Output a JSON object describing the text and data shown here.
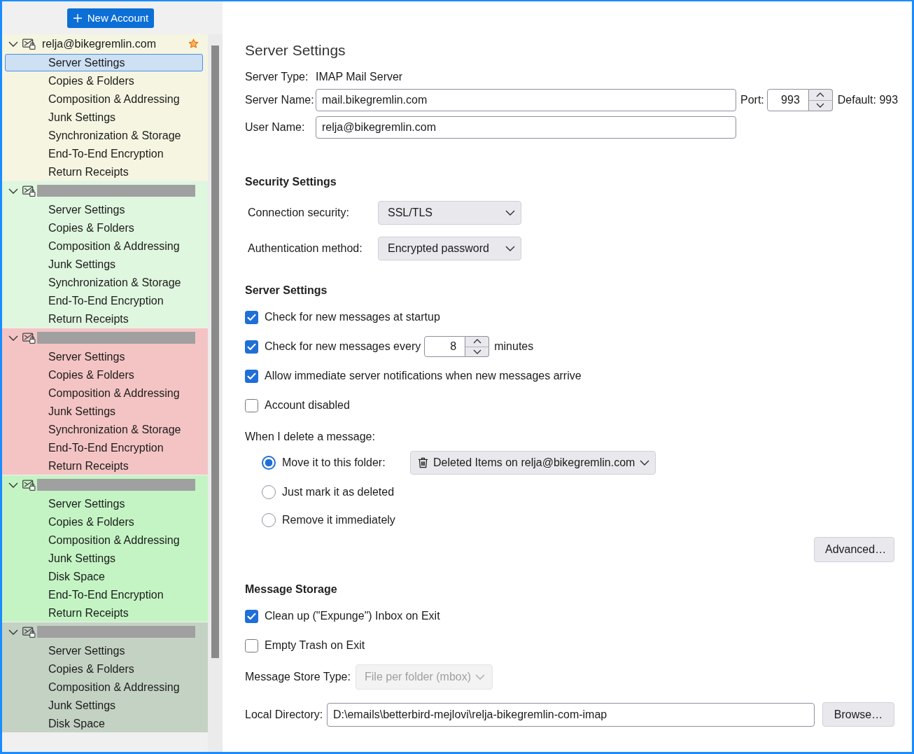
{
  "sidebar": {
    "new_account_button": "New Account",
    "accounts": [
      {
        "name": "relja@bikegremlin.com",
        "redacted": false,
        "default": true,
        "expanded": true,
        "color": "#f5f5e1",
        "items": [
          {
            "label": "Server Settings",
            "selected": true
          },
          {
            "label": "Copies & Folders",
            "selected": false
          },
          {
            "label": "Composition & Addressing",
            "selected": false
          },
          {
            "label": "Junk Settings",
            "selected": false
          },
          {
            "label": "Synchronization & Storage",
            "selected": false
          },
          {
            "label": "End-To-End Encryption",
            "selected": false
          },
          {
            "label": "Return Receipts",
            "selected": false
          }
        ]
      },
      {
        "redacted": true,
        "default": false,
        "expanded": true,
        "color": "#dff6df",
        "items": [
          {
            "label": "Server Settings",
            "selected": false
          },
          {
            "label": "Copies & Folders",
            "selected": false
          },
          {
            "label": "Composition & Addressing",
            "selected": false
          },
          {
            "label": "Junk Settings",
            "selected": false
          },
          {
            "label": "Synchronization & Storage",
            "selected": false
          },
          {
            "label": "End-To-End Encryption",
            "selected": false
          },
          {
            "label": "Return Receipts",
            "selected": false
          }
        ]
      },
      {
        "redacted": true,
        "default": false,
        "expanded": true,
        "color": "#f4c4c4",
        "items": [
          {
            "label": "Server Settings",
            "selected": false
          },
          {
            "label": "Copies & Folders",
            "selected": false
          },
          {
            "label": "Composition & Addressing",
            "selected": false
          },
          {
            "label": "Junk Settings",
            "selected": false
          },
          {
            "label": "Synchronization & Storage",
            "selected": false
          },
          {
            "label": "End-To-End Encryption",
            "selected": false
          },
          {
            "label": "Return Receipts",
            "selected": false
          }
        ]
      },
      {
        "redacted": true,
        "default": false,
        "expanded": true,
        "color": "#c4f4c4",
        "items": [
          {
            "label": "Server Settings",
            "selected": false
          },
          {
            "label": "Copies & Folders",
            "selected": false
          },
          {
            "label": "Composition & Addressing",
            "selected": false
          },
          {
            "label": "Junk Settings",
            "selected": false
          },
          {
            "label": "Disk Space",
            "selected": false
          },
          {
            "label": "End-To-End Encryption",
            "selected": false
          },
          {
            "label": "Return Receipts",
            "selected": false
          }
        ]
      },
      {
        "redacted": true,
        "default": false,
        "expanded": true,
        "color": "#c4d2c4",
        "items": [
          {
            "label": "Server Settings",
            "selected": false
          },
          {
            "label": "Copies & Folders",
            "selected": false
          },
          {
            "label": "Composition & Addressing",
            "selected": false
          },
          {
            "label": "Junk Settings",
            "selected": false
          },
          {
            "label": "Disk Space",
            "selected": false
          }
        ]
      }
    ]
  },
  "panel": {
    "title": "Server Settings",
    "server_type": {
      "label": "Server Type:",
      "value": "IMAP Mail Server"
    },
    "server_name": {
      "label": "Server Name:",
      "value": "mail.bikegremlin.com"
    },
    "port": {
      "label": "Port:",
      "value": "993",
      "default": "Default: 993"
    },
    "user_name": {
      "label": "User Name:",
      "value": "relja@bikegremlin.com"
    },
    "security": {
      "heading": "Security Settings",
      "fields": [
        {
          "label": "Connection security:",
          "value": "SSL/TLS"
        },
        {
          "label": "Authentication method:",
          "value": "Encrypted password"
        }
      ]
    },
    "server_settings": {
      "heading": "Server Settings",
      "options": [
        {
          "kind": "checkbox",
          "label": "Check for new messages at startup",
          "checked": true
        },
        {
          "kind": "interval",
          "label": "Check for new messages every",
          "checked": true,
          "value": "8",
          "unit": "minutes"
        },
        {
          "kind": "checkbox",
          "label": "Allow immediate server notifications when new messages arrive",
          "checked": true
        },
        {
          "kind": "checkbox",
          "label": "Account disabled",
          "checked": false
        }
      ],
      "delete_label": "When I delete a message:",
      "delete_options": [
        {
          "label": "Move it to this folder:",
          "selected": true,
          "folder": "Deleted Items on relja@bikegremlin.com"
        },
        {
          "label": "Just mark it as deleted",
          "selected": false
        },
        {
          "label": "Remove it immediately",
          "selected": false
        }
      ],
      "advanced_button": "Advanced…"
    },
    "message_storage": {
      "heading": "Message Storage",
      "options": [
        {
          "kind": "checkbox",
          "label": "Clean up (\"Expunge\") Inbox on Exit",
          "checked": true
        },
        {
          "kind": "checkbox",
          "label": "Empty Trash on Exit",
          "checked": false
        }
      ],
      "store_type": {
        "label": "Message Store Type:",
        "value": "File per folder (mbox)",
        "disabled": true
      },
      "local_directory": {
        "label": "Local Directory:",
        "value": "D:\\emails\\betterbird-mejlovi\\relja-bikegremlin-com-imap"
      },
      "browse_button": "Browse…"
    }
  }
}
